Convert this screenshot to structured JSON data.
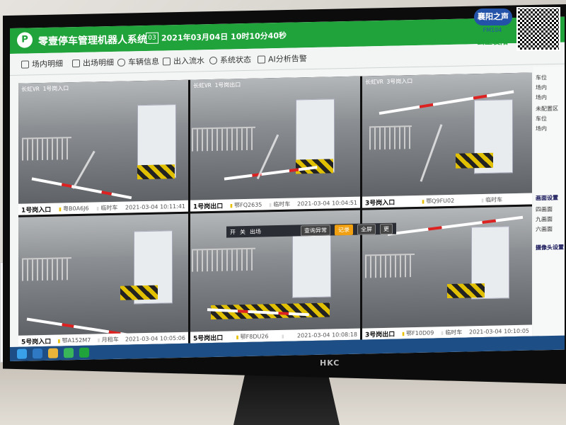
{
  "app": {
    "title": "零壹停车管理机器人系统",
    "date_box": "03",
    "datetime": "2021年03月04日 10时10分40秒"
  },
  "menu": [
    {
      "label": "场内明细",
      "icon": "list-icon"
    },
    {
      "label": "出场明细",
      "icon": "exit-list-icon"
    },
    {
      "label": "车辆信息",
      "icon": "car-icon"
    },
    {
      "label": "出入流水",
      "icon": "flow-icon"
    },
    {
      "label": "系统状态",
      "icon": "gear-icon"
    },
    {
      "label": "AI分析告警",
      "icon": "ai-alert-icon"
    }
  ],
  "cameras": [
    {
      "osd": "长虹VR 1号岗入口",
      "gate": "1号岗入口",
      "plate": "粤B0A6J6",
      "type": "临时车",
      "time": "2021-03-04 10:11:41"
    },
    {
      "osd": "长虹VR 1号岗出口",
      "gate": "1号岗出口",
      "plate": "鄂FQ2635",
      "type": "临时车",
      "time": "2021-03-04 10:04:51"
    },
    {
      "osd": "长虹VR 3号岗入口",
      "gate": "3号岗入口",
      "plate": "鄂Q9FU02",
      "type": "临时车",
      "time": ""
    },
    {
      "osd": "",
      "gate": "5号岗入口",
      "plate": "鄂A152M7",
      "type": "月租车",
      "time": "2021-03-04 10:05:06"
    },
    {
      "osd": "",
      "gate": "5号岗出口",
      "plate": "鄂F8DU26",
      "type": "",
      "time": "2021-03-04 10:08:18"
    },
    {
      "osd": "",
      "gate": "3号岗出口",
      "plate": "鄂F10D09",
      "type": "临时车",
      "time": "2021-03-04 10:10:05"
    }
  ],
  "controls": {
    "open": "开",
    "close": "关",
    "exit": "出场",
    "query_abnormal": "查询异常",
    "record": "记录",
    "fullscreen": "全屏",
    "more": "更"
  },
  "right_panel": {
    "items": [
      "车位",
      "场内",
      "场内",
      "未配置区",
      "车位",
      "场内"
    ],
    "sections": [
      "画面设置",
      "四画面",
      "九画面",
      "六画面"
    ],
    "camera_settings": "摄像头设置"
  },
  "watermark": {
    "badge": "襄阳之声",
    "fm": "FM104",
    "sub": "云上襄阳"
  },
  "monitor_brand": "HKC"
}
